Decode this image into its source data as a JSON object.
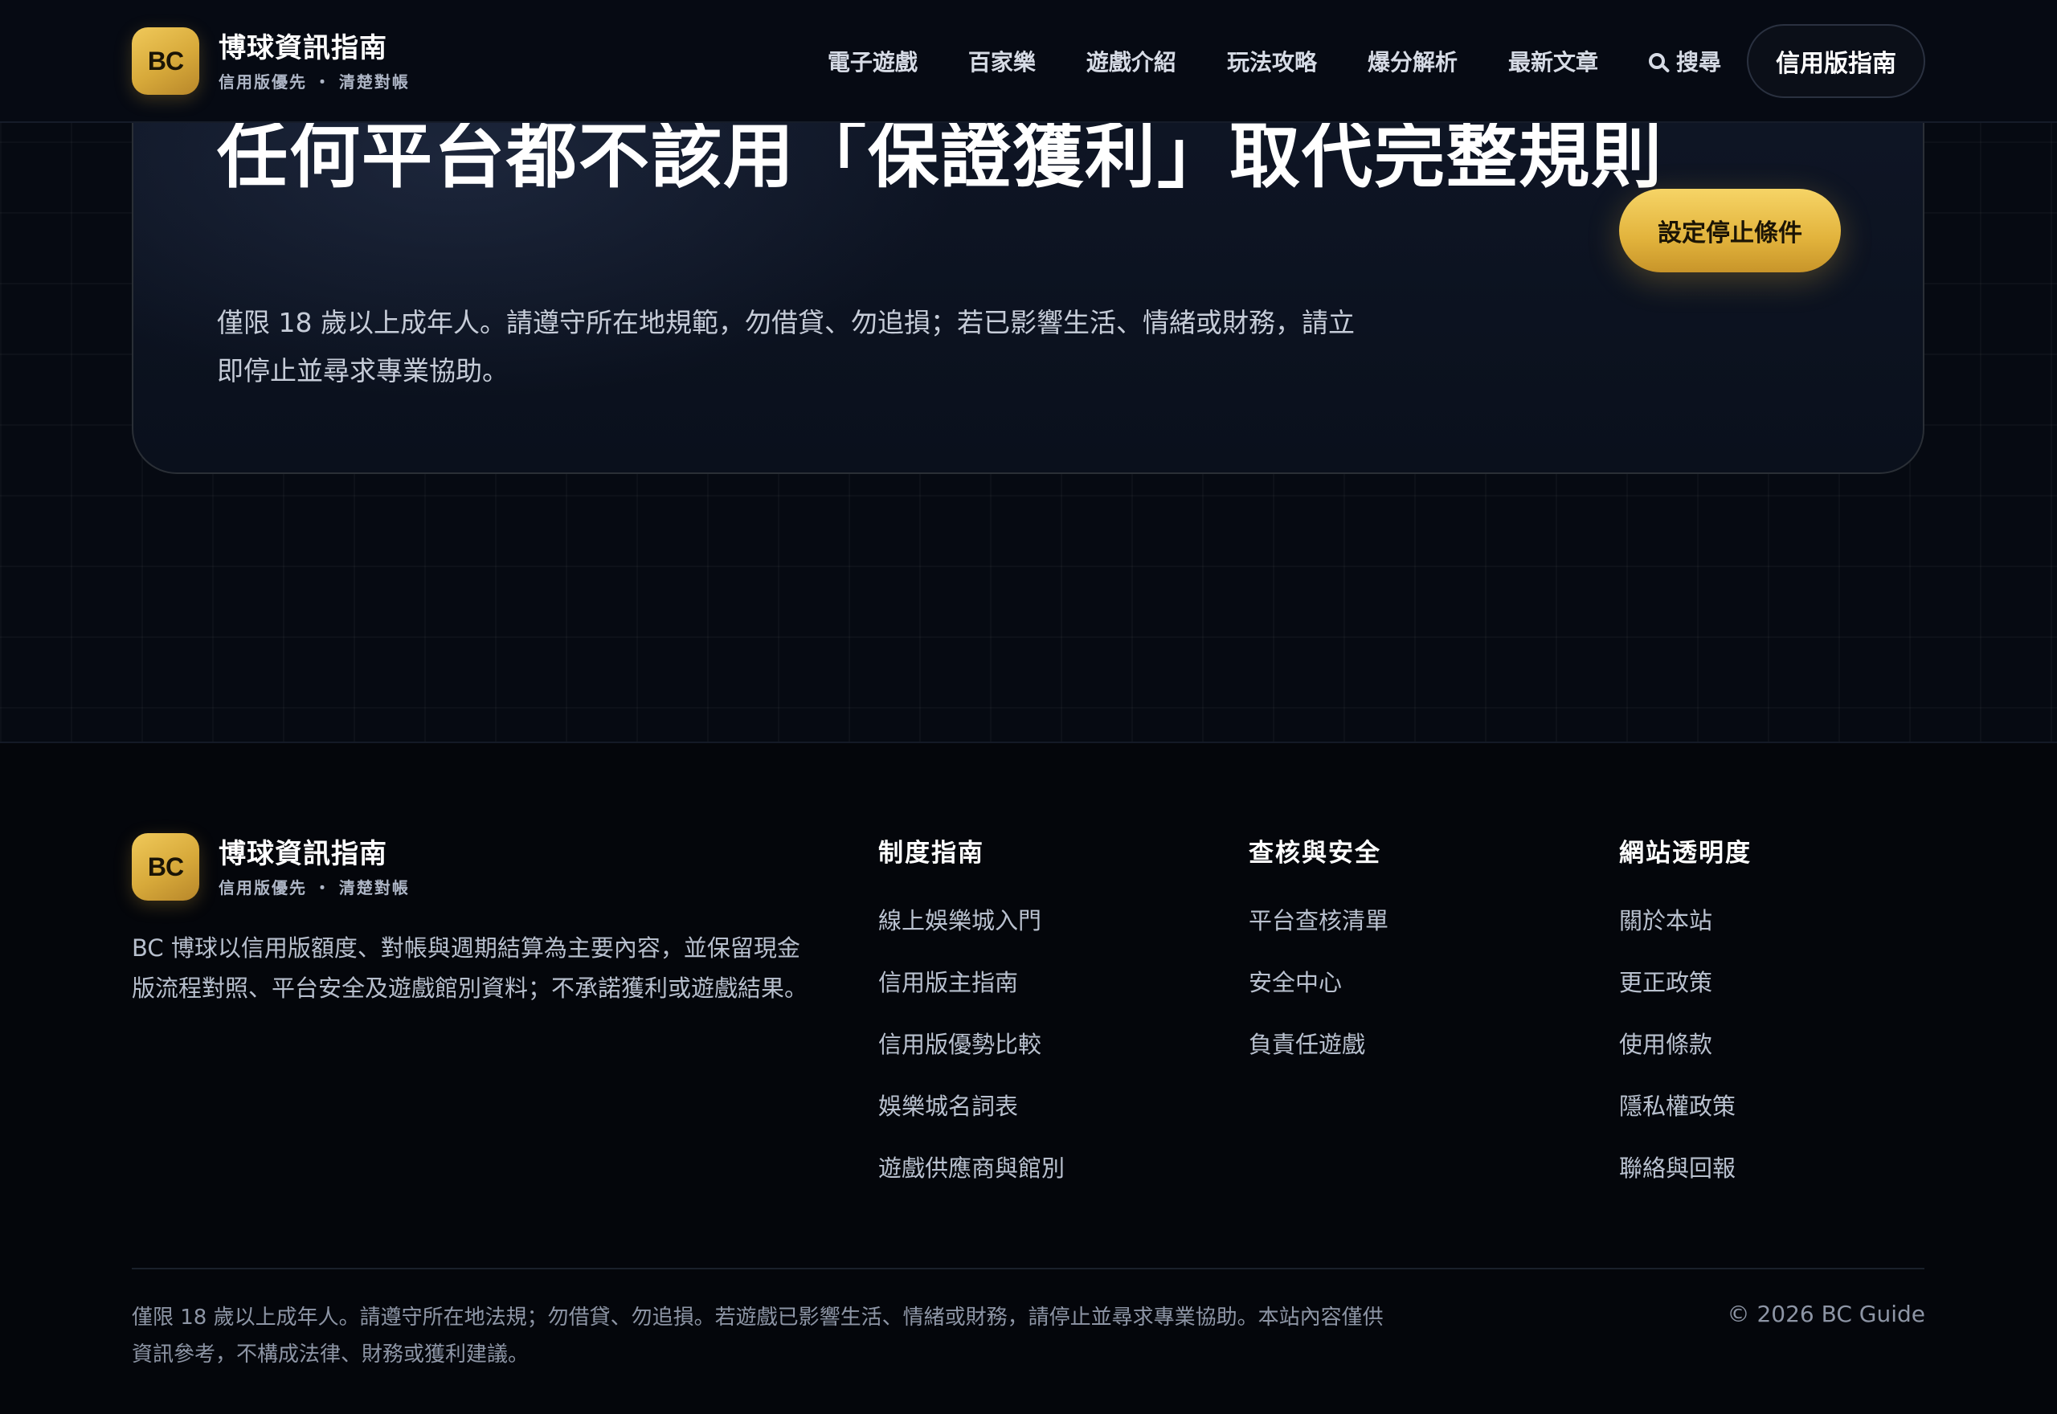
{
  "brand": {
    "logo_text": "BC",
    "name": "博球資訊指南",
    "tagline": "信用版優先 ・ 清楚對帳"
  },
  "nav": {
    "items": [
      {
        "label": "電子遊戲"
      },
      {
        "label": "百家樂"
      },
      {
        "label": "遊戲介紹"
      },
      {
        "label": "玩法攻略"
      },
      {
        "label": "爆分解析"
      },
      {
        "label": "最新文章"
      }
    ],
    "search_label": "搜尋",
    "cta_label": "信用版指南"
  },
  "hero": {
    "title": "任何平台都不該用「保證獲利」取代完整規則",
    "description": "僅限 18 歲以上成年人。請遵守所在地規範，勿借貸、勿追損；若已影響生活、情緒或財務，請立即停止並尋求專業協助。",
    "button_label": "設定停止條件"
  },
  "footer": {
    "about": "BC 博球以信用版額度、對帳與週期結算為主要內容，並保留現金版流程對照、平台安全及遊戲館別資料；不承諾獲利或遊戲結果。",
    "columns": [
      {
        "title": "制度指南",
        "links": [
          "線上娛樂城入門",
          "信用版主指南",
          "信用版優勢比較",
          "娛樂城名詞表",
          "遊戲供應商與館別"
        ]
      },
      {
        "title": "查核與安全",
        "links": [
          "平台查核清單",
          "安全中心",
          "負責任遊戲"
        ]
      },
      {
        "title": "網站透明度",
        "links": [
          "關於本站",
          "更正政策",
          "使用條款",
          "隱私權政策",
          "聯絡與回報"
        ]
      }
    ],
    "legal": "僅限 18 歲以上成年人。請遵守所在地法規；勿借貸、勿追損。若遊戲已影響生活、情緒或財務，請停止並尋求專業協助。本站內容僅供資訊參考，不構成法律、財務或獲利建議。",
    "copyright": "© 2026 BC Guide"
  },
  "colors": {
    "accent_gold": "#e2b33c",
    "background": "#04060b",
    "card": "#0f1626"
  },
  "icons": {
    "search": "search-icon"
  }
}
